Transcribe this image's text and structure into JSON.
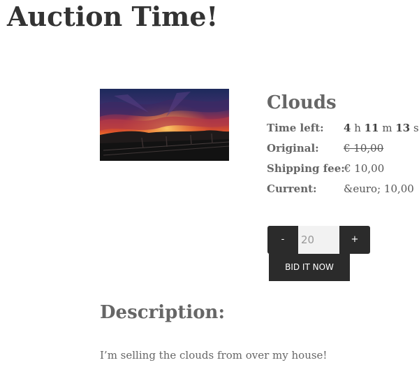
{
  "page": {
    "title": "Auction Time!"
  },
  "item": {
    "name": "Clouds",
    "image_subject": "sunset-clouds-over-water-photo",
    "time_left": {
      "label": "Time left:",
      "hours": "4",
      "hours_unit": "h",
      "minutes": "11",
      "minutes_unit": "m",
      "seconds": "13",
      "seconds_unit": "s"
    },
    "original": {
      "label": "Original:",
      "value": "€ 10,00"
    },
    "shipping": {
      "label": "Shipping fee:",
      "value": "€ 10,00"
    },
    "current": {
      "label": "Current:",
      "value": "&euro; 10,00"
    }
  },
  "bid": {
    "minus_label": "-",
    "plus_label": "+",
    "amount": "20",
    "button_label": "BID IT NOW"
  },
  "description": {
    "heading": "Description:",
    "text": "I’m selling the clouds from over my house!"
  },
  "colors": {
    "button_bg": "#2b2b2b",
    "button_text": "#ffffff",
    "input_bg": "#f2f2f2",
    "title_text": "#333333",
    "label_text": "#666666"
  }
}
